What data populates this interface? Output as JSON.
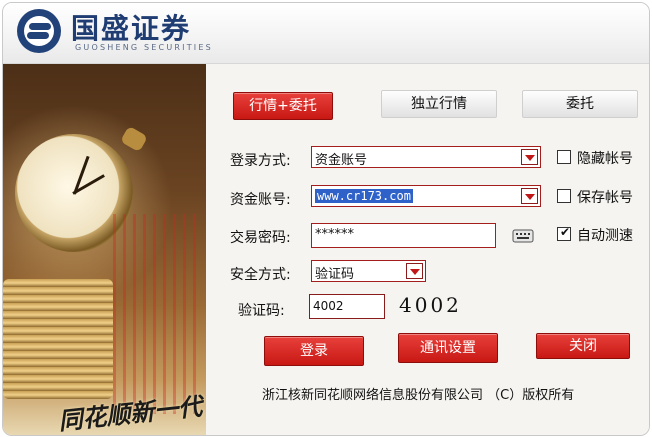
{
  "brand": {
    "name": "国盛证券",
    "sub": "GUOSHENG SECURITIES"
  },
  "art": {
    "caption": "同花顺新一代"
  },
  "modes": [
    {
      "label": "行情+委托",
      "active": true
    },
    {
      "label": "独立行情",
      "active": false
    },
    {
      "label": "委托",
      "active": false
    }
  ],
  "login_method": {
    "label": "登录方式:",
    "value": "资金账号"
  },
  "account": {
    "label": "资金账号:",
    "value": "www.cr173.com"
  },
  "password": {
    "label": "交易密码:",
    "value": "******"
  },
  "security": {
    "label": "安全方式:",
    "value": "验证码"
  },
  "captcha": {
    "label": "验证码:",
    "value": "4002",
    "image_text": "4002"
  },
  "options": [
    {
      "label": "隐藏帐号",
      "checked": false
    },
    {
      "label": "保存帐号",
      "checked": false
    },
    {
      "label": "自动测速",
      "checked": true
    }
  ],
  "actions": {
    "login": "登录",
    "comm_settings": "通讯设置",
    "close": "关闭"
  },
  "footer": "浙江核新同花顺网络信息股份有限公司 （C）版权所有",
  "colors": {
    "accent_red": "#d42420",
    "brand_blue": "#1f3c73"
  }
}
